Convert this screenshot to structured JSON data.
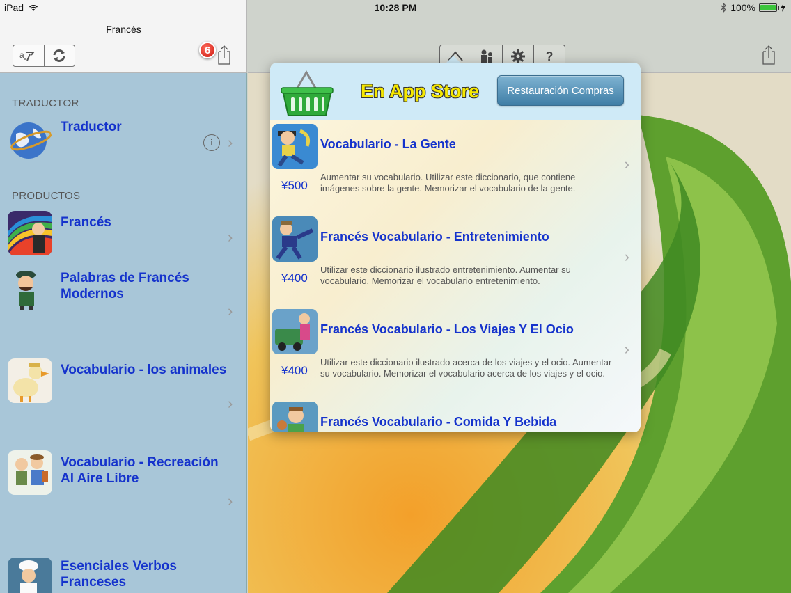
{
  "status": {
    "device": "iPad",
    "time": "10:28 PM",
    "battery": "100%"
  },
  "left": {
    "title": "Francés",
    "badge_count": "6",
    "sections": [
      {
        "header": "TRADUCTOR",
        "items": [
          {
            "label": "Traductor"
          }
        ]
      },
      {
        "header": "PRODUCTOS",
        "items": [
          {
            "label": "Francés"
          },
          {
            "label": "Palabras de Francés Modernos"
          },
          {
            "label": "Vocabulario - los animales"
          },
          {
            "label": "Vocabulario - Recreación Al Aire Libre"
          },
          {
            "label": "Esenciales Verbos Franceses"
          }
        ]
      }
    ]
  },
  "toolbar": {
    "help_label": "?"
  },
  "store": {
    "title": "En App Store",
    "restore_label": "Restauración Compras",
    "products": [
      {
        "title": "Vocabulario - La Gente",
        "price": "¥500",
        "desc": "Aumentar su vocabulario.  Utilizar este diccionario, que contiene imágenes sobre la gente.  Memorizar el vocabulario de la gente."
      },
      {
        "title": "Francés Vocabulario - Entretenimiento",
        "price": "¥400",
        "desc": "Utilizar este diccionario ilustrado entretenimiento.  Aumentar su vocabulario.  Memorizar el vocabulario entretenimiento."
      },
      {
        "title": "Francés Vocabulario - Los Viajes Y El Ocio",
        "price": "¥400",
        "desc": "Utilizar este diccionario ilustrado acerca de los viajes y el ocio.  Aumentar su vocabulario.  Memorizar el vocabulario acerca de los viajes y el ocio."
      },
      {
        "title": "Francés Vocabulario - Comida Y Bebida",
        "price": "",
        "desc": ""
      }
    ]
  }
}
